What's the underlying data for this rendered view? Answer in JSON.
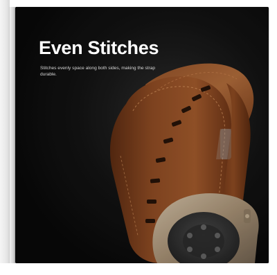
{
  "slide": {
    "headline": "Even Stitches",
    "subtext": "Stitches evenly space along both sides, making the strap durable."
  },
  "image": {
    "subject": "Brown leather watch strap with even stitching wrapped around a smartwatch case",
    "colors": {
      "background": "#111111",
      "leather": "#8a4a24",
      "leather_highlight": "#b06a38",
      "case_metal": "#b9a48a",
      "sensor_back": "#3a3a3a"
    }
  }
}
